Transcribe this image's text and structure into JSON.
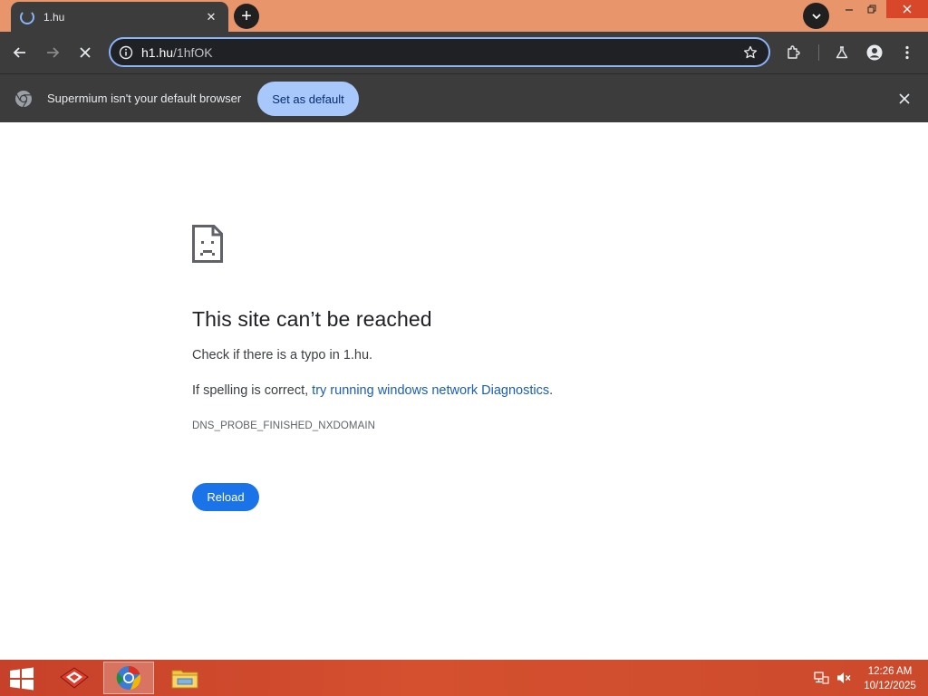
{
  "browser": {
    "tab": {
      "title": "1.hu",
      "status": "loading"
    },
    "address": {
      "host": "h1.hu",
      "path": "/1hfOK"
    },
    "infobar": {
      "message": "Supermium isn't your default browser",
      "action_label": "Set as default"
    }
  },
  "error_page": {
    "title": "This site can’t be reached",
    "line1": "Check if there is a typo in 1.hu.",
    "line2_prefix": "If spelling is correct, ",
    "line2_link": "try running windows network Diagnostics",
    "line2_suffix": ".",
    "error_code": "DNS_PROBE_FINISHED_NXDOMAIN",
    "reload_label": "Reload"
  },
  "taskbar": {
    "apps": [
      "app-icon",
      "supermium-browser-icon",
      "file-explorer-icon"
    ],
    "clock": {
      "time": "12:26 AM",
      "date": "10/12/2025"
    }
  },
  "colors": {
    "accent_blue": "#1a73e8",
    "link_blue": "#1a5eb8",
    "omnibox_focus": "#8ab4f8",
    "title_bar": "#e8956b",
    "taskbar": "#cc4a2c",
    "chrome_dark": "#3c3c3c"
  }
}
